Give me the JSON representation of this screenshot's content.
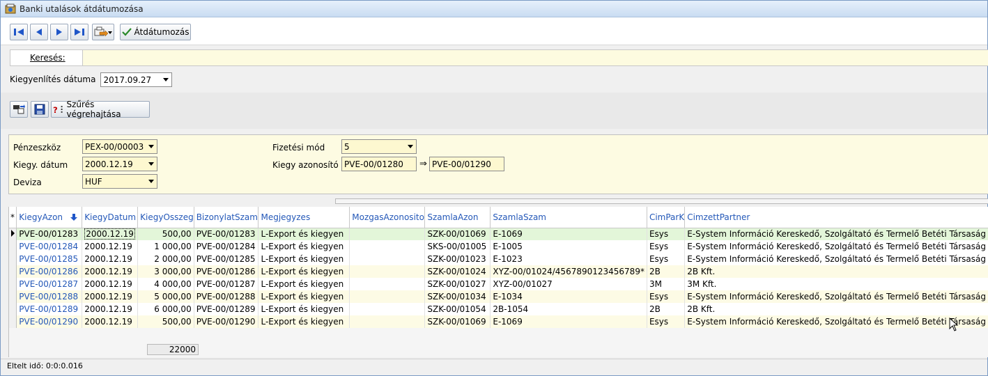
{
  "window": {
    "title": "Banki utalások átdátumozása"
  },
  "toolbar": {
    "redate_label": "Átdátumozás"
  },
  "search": {
    "label": "Keresés:",
    "value": ""
  },
  "date_row": {
    "label": "Kiegyenlítés dátuma",
    "value": "2017.09.27"
  },
  "filter_tools": {
    "apply_label": "Szűrés végrehajtása"
  },
  "filter": {
    "penzeszkoz_label": "Pénzeszköz",
    "penzeszkoz_value": "PEX-00/00003",
    "kiegy_datum_label": "Kiegy. dátum",
    "kiegy_datum_value": "2000.12.19",
    "deviza_label": "Deviza",
    "deviza_value": "HUF",
    "fizetesi_mod_label": "Fizetési mód",
    "fizetesi_mod_value": "5",
    "kiegy_azonosito_label": "Kiegy azonosító",
    "azon_from": "PVE-00/01280",
    "azon_arrow": "⇒",
    "azon_to": "PVE-00/01290"
  },
  "grid": {
    "columns": [
      "*",
      "KiegyAzon",
      "KiegyDatum",
      "KiegyOsszeg",
      "BizonylatSzam",
      "Megjegyzes",
      "MozgasAzonosito",
      "SzamlaAzon",
      "SzamlaSzam",
      "CimParK",
      "CimzettPartner"
    ],
    "rows": [
      [
        "PVE-00/01283",
        "2000.12.19",
        "500,00",
        "PVE-00/01283",
        "L-Export és kiegyen",
        "",
        "SZK-00/01069",
        "E-1069",
        "Esys",
        "E-System Információ Kereskedő, Szolgáltató és Termelő Betéti Társaság"
      ],
      [
        "PVE-00/01284",
        "2000.12.19",
        "1 000,00",
        "PVE-00/01284",
        "L-Export és kiegyen",
        "",
        "SKS-00/01005",
        "E-1005",
        "Esys",
        "E-System Információ Kereskedő, Szolgáltató és Termelő Betéti Társaság"
      ],
      [
        "PVE-00/01285",
        "2000.12.19",
        "2 000,00",
        "PVE-00/01285",
        "L-Export és kiegyen",
        "",
        "SZK-00/01023",
        "E-1023",
        "Esys",
        "E-System Információ Kereskedő, Szolgáltató és Termelő Betéti Társaság"
      ],
      [
        "PVE-00/01286",
        "2000.12.19",
        "3 000,00",
        "PVE-00/01286",
        "L-Export és kiegyen",
        "",
        "SZK-00/01024",
        "XYZ-00/01024/4567890123456789*",
        "2B",
        "2B Kft."
      ],
      [
        "PVE-00/01287",
        "2000.12.19",
        "4 000,00",
        "PVE-00/01287",
        "L-Export és kiegyen",
        "",
        "SZK-00/01027",
        "XYZ-00/01027",
        "3M",
        "3M Kft."
      ],
      [
        "PVE-00/01288",
        "2000.12.19",
        "5 000,00",
        "PVE-00/01288",
        "L-Export és kiegyen",
        "",
        "SZK-00/01034",
        "E-1034",
        "Esys",
        "E-System Információ Kereskedő, Szolgáltató és Termelő Betéti Társaság"
      ],
      [
        "PVE-00/01289",
        "2000.12.19",
        "6 000,00",
        "PVE-00/01289",
        "L-Export és kiegyen",
        "",
        "SZK-00/01054",
        "2B-1054",
        "2B",
        "2B Kft."
      ],
      [
        "PVE-00/01290",
        "2000.12.19",
        "500,00",
        "PVE-00/01290",
        "L-Export és kiegyen",
        "",
        "SZK-00/01069",
        "E-1069",
        "Esys",
        "E-System Információ Kereskedő, Szolgáltató és Termelő Betéti Társaság"
      ]
    ],
    "sum": "22000"
  },
  "status": {
    "elapsed": "Eltelt idő: 0:0:0.016"
  },
  "colors": {
    "accent": "#2458b8",
    "nav_icon": "#1f56c8",
    "selected_row": "#e3f6d9",
    "stripe": "#fdfbe5"
  },
  "icons": [
    "first-icon",
    "prev-icon",
    "next-icon",
    "last-icon",
    "export-icon",
    "check-icon",
    "filter-icon",
    "save-icon",
    "help-icon"
  ]
}
